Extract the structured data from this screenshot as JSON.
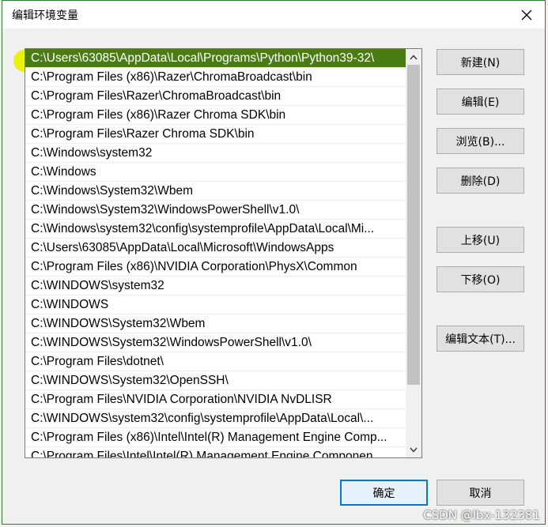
{
  "dialog": {
    "title": "编辑环境变量",
    "close_label": "✕"
  },
  "path_list": {
    "entries": [
      "C:\\Users\\63085\\AppData\\Local\\Programs\\Python\\Python39-32\\",
      "C:\\Program Files (x86)\\Razer\\ChromaBroadcast\\bin",
      "C:\\Program Files\\Razer\\ChromaBroadcast\\bin",
      "C:\\Program Files (x86)\\Razer Chroma SDK\\bin",
      "C:\\Program Files\\Razer Chroma SDK\\bin",
      "C:\\Windows\\system32",
      "C:\\Windows",
      "C:\\Windows\\System32\\Wbem",
      "C:\\Windows\\System32\\WindowsPowerShell\\v1.0\\",
      "C:\\Windows\\system32\\config\\systemprofile\\AppData\\Local\\Mi...",
      "C:\\Users\\63085\\AppData\\Local\\Microsoft\\WindowsApps",
      "C:\\Program Files (x86)\\NVIDIA Corporation\\PhysX\\Common",
      "C:\\WINDOWS\\system32",
      "C:\\WINDOWS",
      "C:\\WINDOWS\\System32\\Wbem",
      "C:\\WINDOWS\\System32\\WindowsPowerShell\\v1.0\\",
      "C:\\Program Files\\dotnet\\",
      "C:\\WINDOWS\\System32\\OpenSSH\\",
      "C:\\Program Files\\NVIDIA Corporation\\NVIDIA NvDLISR",
      "C:\\WINDOWS\\system32\\config\\systemprofile\\AppData\\Local\\...",
      "C:\\Program Files (x86)\\Intel\\Intel(R) Management Engine Comp...",
      "C:\\Program Files\\Intel\\Intel(R) Management Engine Componen..."
    ],
    "selected_index": 0
  },
  "buttons": {
    "new": "新建(N)",
    "edit": "编辑(E)",
    "browse": "浏览(B)...",
    "delete": "删除(D)",
    "move_up": "上移(U)",
    "move_down": "下移(O)",
    "edit_text": "编辑文本(T)...",
    "ok": "确定",
    "cancel": "取消"
  },
  "colors": {
    "selection": "#4a7c16",
    "marker_highlight": "#eaf012",
    "primary_border": "#0078d7"
  },
  "watermark": "CSDN @lbx-132381"
}
